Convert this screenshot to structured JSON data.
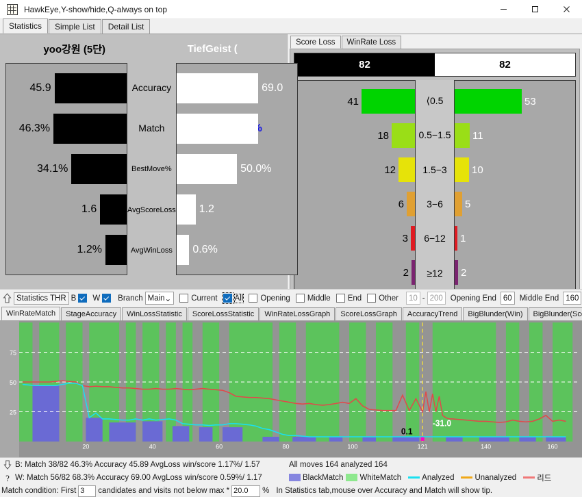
{
  "window": {
    "title": "HawkEye,Y-show/hide,Q-always on top",
    "icon": "app-grid-icon",
    "minimize": "─",
    "maximize": "□",
    "close": "✕"
  },
  "top_tabs": [
    {
      "label": "Statistics",
      "active": true
    },
    {
      "label": "Simple List",
      "active": false
    },
    {
      "label": "Detail List",
      "active": false
    }
  ],
  "comparison": {
    "black_player": "yoo강원 (5단)",
    "white_player": "TiefGeist (",
    "rows": [
      {
        "label": "Accuracy",
        "label_size": "big",
        "black_value": "45.9",
        "white_value": "69.0",
        "black_pct": 68,
        "white_pct": 77,
        "highlight": false
      },
      {
        "label": "Match",
        "label_size": "big",
        "black_value": "46.3%",
        "white_value": "68.3%",
        "black_pct": 69,
        "white_pct": 77,
        "highlight": true
      },
      {
        "label": "BestMove%",
        "label_size": "small",
        "black_value": "34.1%",
        "white_value": "50.0%",
        "black_pct": 52,
        "white_pct": 57,
        "highlight": false
      },
      {
        "label": "AvgScoreLoss",
        "label_size": "small",
        "black_value": "1.6",
        "white_value": "1.2",
        "black_pct": 25,
        "white_pct": 18,
        "highlight": false
      },
      {
        "label": "AvgWinLoss",
        "label_size": "small",
        "black_value": "1.2%",
        "white_value": "0.6%",
        "black_pct": 20,
        "white_pct": 12,
        "highlight": false
      }
    ]
  },
  "loss_panel": {
    "tabs": [
      {
        "label": "Score Loss",
        "active": true
      },
      {
        "label": "WinRate Loss",
        "active": false
      }
    ],
    "header_black": "82",
    "header_white": "82",
    "bins": [
      {
        "label": "⟨0.5",
        "black": "41",
        "white": "53",
        "black_pct": 78,
        "white_pct": 98,
        "color": "#00d400"
      },
      {
        "label": "0.5−1.5",
        "black": "18",
        "white": "11",
        "black_pct": 34,
        "white_pct": 22,
        "color": "#9ade17"
      },
      {
        "label": "1.5−3",
        "black": "12",
        "white": "10",
        "black_pct": 24,
        "white_pct": 21,
        "color": "#e6e309"
      },
      {
        "label": "3−6",
        "black": "6",
        "white": "5",
        "black_pct": 12,
        "white_pct": 11,
        "color": "#e0a032"
      },
      {
        "label": "6−12",
        "black": "3",
        "white": "1",
        "black_pct": 6,
        "white_pct": 4,
        "color": "#e01b22"
      },
      {
        "label": "≥12",
        "black": "2",
        "white": "2",
        "black_pct": 5,
        "white_pct": 5,
        "color": "#7b2470"
      }
    ]
  },
  "filterbar": {
    "up_icon": "up-arrow-icon",
    "stats_thr": "Statistics THR",
    "b_label": "B",
    "b_checked": true,
    "w_label": "W",
    "w_checked": true,
    "branch_label": "Branch",
    "branch_value": "Main",
    "branch_caret": "⌄",
    "current_label": "Current",
    "current_checked": false,
    "all_label": "All",
    "all_checked": true,
    "opening_label": "Opening",
    "opening_checked": false,
    "middle_label": "Middle",
    "middle_checked": false,
    "end_label": "End",
    "end_checked": false,
    "other_label": "Other",
    "other_checked": false,
    "other_from": "10",
    "other_dash": "-",
    "other_to": "200",
    "opening_end_label": "Opening End",
    "opening_end_value": "60",
    "middle_end_label": "Middle End",
    "middle_end_value": "160"
  },
  "bottom_tabs": [
    {
      "label": "WinRateMatch",
      "active": true
    },
    {
      "label": "StageAccuracy",
      "active": false
    },
    {
      "label": "WinLossStatistic",
      "active": false
    },
    {
      "label": "ScoreLossStatistic",
      "active": false
    },
    {
      "label": "WinRateLossGraph",
      "active": false
    },
    {
      "label": "ScoreLossGraph",
      "active": false
    },
    {
      "label": "AccuracyTrend",
      "active": false
    },
    {
      "label": "BigBlunder(Win)",
      "active": false
    },
    {
      "label": "BigBlunder(Score)",
      "active": false
    }
  ],
  "chart_data": {
    "type": "line",
    "title": "WinRateMatch",
    "xlabel": "",
    "ylabel": "",
    "xlim": [
      0,
      168
    ],
    "ylim": [
      0,
      100
    ],
    "grid": true,
    "ytick_labels": [
      "25",
      "50",
      "75"
    ],
    "yticks": [
      25,
      50,
      75
    ],
    "xtick_labels": [
      "20",
      "40",
      "60",
      "80",
      "100",
      "121",
      "140",
      "160"
    ],
    "xticks": [
      20,
      40,
      60,
      80,
      100,
      121,
      140,
      160
    ],
    "legend_position": "status-bar",
    "annotations": [
      {
        "text": "0.1",
        "x": 118,
        "y": 6,
        "color": "#000000"
      },
      {
        "text": "-31.0",
        "x": 124,
        "y": 13,
        "color": "#ffffff"
      }
    ],
    "cursor_move": 121,
    "series": [
      {
        "name": "리드",
        "type": "line",
        "color": "#e04a4a",
        "x": [
          1,
          3,
          5,
          7,
          9,
          11,
          13,
          15,
          17,
          19,
          21,
          23,
          25,
          27,
          29,
          31,
          33,
          35,
          37,
          39,
          41,
          43,
          45,
          47,
          49,
          51,
          53,
          55,
          57,
          59,
          61,
          63,
          65,
          67,
          69,
          71,
          73,
          75,
          77,
          79,
          81,
          83,
          85,
          87,
          89,
          91,
          93,
          95,
          97,
          99,
          101,
          103,
          105,
          107,
          109,
          111,
          113,
          115,
          117,
          119,
          121,
          122,
          123,
          124,
          125,
          126,
          127,
          128,
          129,
          130,
          132,
          134,
          136,
          138,
          140,
          142,
          144,
          146,
          148,
          150,
          152,
          154,
          156,
          158,
          160,
          162,
          164
        ],
        "y": [
          50,
          50,
          50,
          50,
          50,
          50.5,
          51,
          50.5,
          50,
          47,
          46,
          46.5,
          46,
          46,
          45.5,
          45,
          45,
          44.5,
          44,
          44,
          44.5,
          44,
          44,
          44.5,
          44,
          43.5,
          44,
          44.5,
          44,
          43.5,
          43,
          41,
          38,
          37.5,
          37,
          37,
          36.5,
          36,
          35,
          34,
          33,
          32,
          31.5,
          32,
          31,
          30.5,
          31,
          32,
          33,
          32,
          36,
          30,
          27,
          26.5,
          26,
          26,
          26,
          39,
          26,
          36,
          25,
          42,
          25,
          40,
          25,
          38,
          22,
          20,
          19,
          19,
          18.5,
          18,
          17.5,
          17,
          17,
          16.5,
          16,
          16.5,
          18,
          17,
          16.5,
          17,
          19,
          22,
          17,
          18,
          17
        ]
      },
      {
        "name": "Analyzed",
        "type": "line",
        "color": "#1ae0f0",
        "x": [
          1,
          3,
          5,
          7,
          9,
          11,
          13,
          15,
          17,
          19,
          21,
          23,
          25,
          27,
          29,
          31,
          33,
          35,
          37,
          39,
          41,
          43,
          45,
          47,
          49,
          51,
          53,
          55,
          57,
          59,
          61,
          63,
          65,
          67,
          69,
          71,
          73,
          75,
          77,
          79,
          81,
          83,
          85,
          87,
          89,
          91,
          93,
          95,
          97,
          99,
          101,
          103,
          105,
          110,
          115,
          120,
          125,
          130,
          135,
          140,
          145,
          150,
          155,
          160,
          164
        ],
        "y": [
          48,
          47.5,
          47,
          47,
          47,
          47,
          48,
          49,
          49,
          47,
          20,
          24,
          19,
          19,
          18.5,
          18,
          18,
          19,
          18,
          19,
          18,
          18.5,
          19,
          18,
          15,
          14.5,
          14,
          14,
          13.5,
          14,
          14,
          15,
          15,
          14.5,
          14,
          13,
          11,
          10,
          8,
          6,
          5,
          5,
          4.5,
          4,
          4,
          4,
          4,
          4,
          4,
          4,
          4,
          4,
          4,
          4,
          4,
          4,
          4,
          4,
          4,
          4,
          4,
          4,
          4,
          4,
          4
        ]
      }
    ],
    "match_bars": {
      "name": "BlackMatch",
      "color": "#6a6ad4",
      "bars": [
        {
          "x": 4,
          "w": 8,
          "h": 47
        },
        {
          "x": 20,
          "w": 5,
          "h": 20
        },
        {
          "x": 27,
          "w": 8,
          "h": 16
        },
        {
          "x": 37,
          "w": 6,
          "h": 17
        },
        {
          "x": 46,
          "w": 5,
          "h": 13
        },
        {
          "x": 54,
          "w": 4,
          "h": 12
        },
        {
          "x": 61,
          "w": 6,
          "h": 12
        },
        {
          "x": 73,
          "w": 5,
          "h": 4
        },
        {
          "x": 82,
          "w": 7,
          "h": 4
        },
        {
          "x": 93,
          "w": 4,
          "h": 4
        },
        {
          "x": 103,
          "w": 4,
          "h": 4
        },
        {
          "x": 112,
          "w": 8,
          "h": 4
        },
        {
          "x": 128,
          "w": 5,
          "h": 4
        },
        {
          "x": 138,
          "w": 9,
          "h": 4
        },
        {
          "x": 150,
          "w": 5,
          "h": 4
        },
        {
          "x": 158,
          "w": 6,
          "h": 4
        }
      ]
    },
    "white_match_bands": {
      "name": "WhiteMatch",
      "color": "#5cc35c",
      "bands": [
        [
          0,
          4
        ],
        [
          6,
          12
        ],
        [
          14,
          19
        ],
        [
          21,
          30
        ],
        [
          32,
          35
        ],
        [
          37,
          42
        ],
        [
          44,
          47
        ],
        [
          49,
          52
        ],
        [
          55,
          60
        ],
        [
          63,
          76
        ],
        [
          78,
          83
        ],
        [
          86,
          96
        ],
        [
          99,
          104
        ],
        [
          107,
          112
        ],
        [
          116,
          120
        ],
        [
          124,
          143
        ],
        [
          146,
          150
        ],
        [
          153,
          157
        ],
        [
          160,
          166
        ]
      ]
    }
  },
  "status": {
    "black_line": "B: Match 38/82 46.3% Accuracy 45.89 AvgLoss win/score 1.17%/ 1.57",
    "white_line": "W: Match 56/82 68.3% Accuracy 69.00 AvgLoss win/score 0.59%/ 1.17",
    "moves_line": "All moves 164 analyzed 164",
    "down_icon": "down-arrow-icon",
    "help_icon": "question-mark-icon",
    "legend": [
      {
        "label": "BlackMatch",
        "color": "#8686e0",
        "kind": "swatch"
      },
      {
        "label": "WhiteMatch",
        "color": "#8ee88e",
        "kind": "swatch"
      },
      {
        "label": "Analyzed",
        "color": "#1ae0f0",
        "kind": "line"
      },
      {
        "label": "Unanalyzed",
        "color": "#f0a818",
        "kind": "line"
      },
      {
        "label": "리드",
        "color": "#f07878",
        "kind": "line"
      }
    ],
    "condition_prefix": "Match condition: First",
    "condition_first": "3",
    "condition_mid": "candidates and visits not below max *",
    "condition_pct": "20.0",
    "condition_pct_sign": "%",
    "tip": "In Statistics tab,mouse over Accuracy and Match will show tip."
  }
}
